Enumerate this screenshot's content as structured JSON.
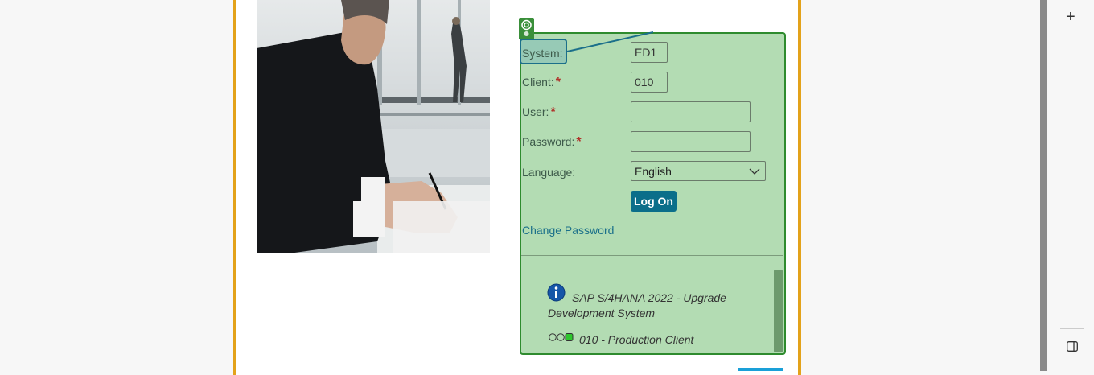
{
  "login": {
    "system_label": "System:",
    "system_value": "ED1",
    "client_label": "Client:",
    "client_value": "010",
    "user_label": "User:",
    "user_value": "",
    "password_label": "Password:",
    "password_value": "",
    "language_label": "Language:",
    "language_value": "English",
    "required_mark": "*",
    "logon_label": "Log On",
    "change_password_label": "Change Password"
  },
  "messages": {
    "system_info": "SAP S/4HANA 2022 - Upgrade Development System",
    "client_info": "010 - Production Client"
  },
  "colors": {
    "panel_bg": "#b3dcb3",
    "panel_border": "#2e8b2e",
    "accent": "#0b6e8a",
    "frame": "#e3a21a"
  },
  "icons": {
    "plus": "+",
    "info": "info-icon",
    "marker": "target-icon"
  }
}
